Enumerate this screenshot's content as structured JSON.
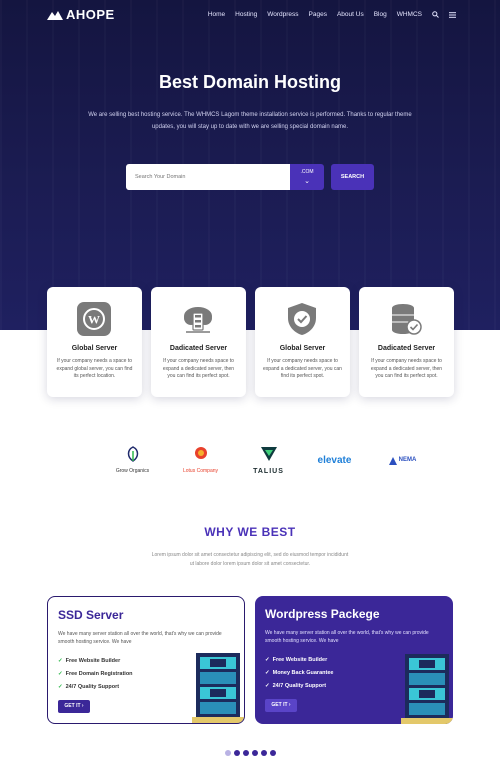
{
  "brand": {
    "name": "AHOPE"
  },
  "nav": {
    "items": [
      "Home",
      "Hosting",
      "Wordpress",
      "Pages",
      "About Us",
      "Blog",
      "WHMCS"
    ],
    "icons": [
      "search-icon",
      "menu-icon"
    ]
  },
  "hero": {
    "title": "Best Domain Hosting",
    "subtitle": "We are selling best hosting service. The WHMCS Lagom theme installation service is performed. Thanks to regular theme updates, you will stay up to date with we are selling special domain name.",
    "search_placeholder": "Search Your Domain",
    "domain_ext": ".COM",
    "search_button": "SEARCH"
  },
  "services": [
    {
      "title": "Global Server",
      "desc": "If your company needs a space to expand global server, you can find its perfect location.",
      "icon": "wordpress-icon"
    },
    {
      "title": "Dadicated Server",
      "desc": "If your company needs space to expand a dedicated server, then you can find its perfect spot.",
      "icon": "cloud-server-icon"
    },
    {
      "title": "Global Server",
      "desc": "If your company needs space to expand a dedicated server, you can find its perfect spot.",
      "icon": "shield-check-icon"
    },
    {
      "title": "Dadicated Server",
      "desc": "If your company needs space to expand a dedicated server, then you can find its perfect spot.",
      "icon": "database-check-icon"
    }
  ],
  "brands": [
    {
      "name": "Grow Organics",
      "icon": "leaf-logo-icon"
    },
    {
      "name": "Lotus Company",
      "icon": "lotus-logo-icon"
    },
    {
      "name": "TALIUS",
      "icon": "talius-logo-icon"
    },
    {
      "name": "elevate",
      "icon": "elevate-logo-icon"
    },
    {
      "name": "NEMA",
      "icon": "nema-logo-icon"
    }
  ],
  "why": {
    "title": "WHY WE BEST",
    "subtitle": "Lorem ipsum dolor sit amet consectetur adipiscing elit, sed do eiusmod tempor incididunt ut labore dolor lorem ipsum dolor sit amet consectetur."
  },
  "features": [
    {
      "title": "SSD Server",
      "desc": "We have many server station all over the world, that's why we can provide smooth hosting service. We have",
      "items": [
        "Free Website Builder",
        "Free Domain Registration",
        "24/7 Quality Support"
      ],
      "button": "GET IT"
    },
    {
      "title": "Wordpress Packege",
      "desc": "We have many server station all over the world, that's why we can provide smooth hosting service. We have",
      "items": [
        "Free Website Builder",
        "Money Back Guarantee",
        "24/7 Quality Support"
      ],
      "button": "GET IT"
    }
  ],
  "pagination": {
    "count": 6,
    "active": 0
  },
  "colors": {
    "primary": "#3b2798",
    "hero_bg": "#1b1c52",
    "accent_green": "#2db84b"
  }
}
